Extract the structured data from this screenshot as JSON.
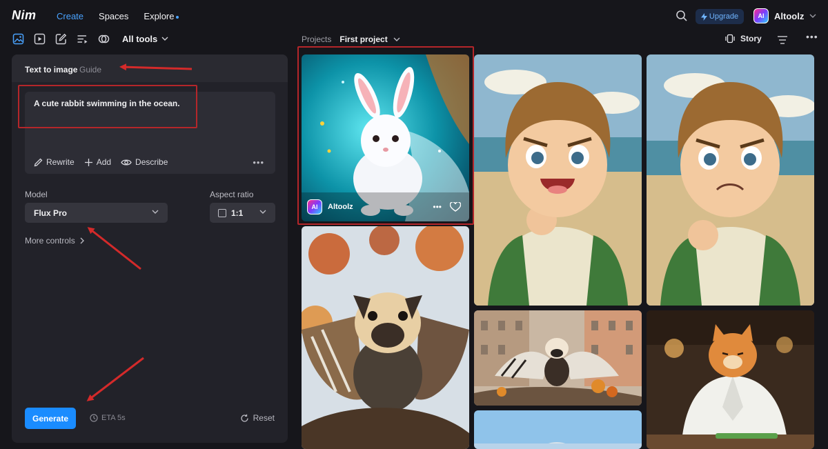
{
  "app": {
    "logo": "Nim"
  },
  "nav": {
    "create": "Create",
    "spaces": "Spaces",
    "explore": "Explore"
  },
  "header": {
    "upgrade_label": "Upgrade",
    "avatar_text": "AI",
    "user_name": "Altoolz"
  },
  "toolbar": {
    "tool_icons": [
      "image-icon",
      "video-icon",
      "edit-icon",
      "playlist-icon",
      "blend-icon"
    ],
    "all_tools_label": "All tools"
  },
  "panel": {
    "title": "Text to image",
    "guide": "Guide",
    "prompt": "A cute rabbit swimming in the ocean.",
    "actions": {
      "rewrite": "Rewrite",
      "add": "Add",
      "describe": "Describe"
    },
    "model_label": "Model",
    "model_value": "Flux Pro",
    "aspect_label": "Aspect ratio",
    "aspect_value": "1:1",
    "more_controls": "More controls",
    "generate": "Generate",
    "eta": "ETA 5s",
    "reset": "Reset"
  },
  "gallery": {
    "breadcrumb_root": "Projects",
    "breadcrumb_current": "First project",
    "story_label": "Story",
    "cards": [
      {
        "subject": "rabbit swimming in ocean",
        "user": "Altoolz",
        "avatar_text": "AI"
      },
      {
        "subject": "anime boy shouting on beach"
      },
      {
        "subject": "anime boy frowning on beach"
      },
      {
        "subject": "winged pug on branch"
      },
      {
        "subject": "winged pug over city"
      },
      {
        "subject": "cat chef cooking"
      },
      {
        "subject": "building under sky"
      }
    ]
  },
  "colors": {
    "accent": "#1a8cff",
    "link": "#4aa3ff",
    "annotation": "#d42a2a",
    "panel": "#222229"
  }
}
